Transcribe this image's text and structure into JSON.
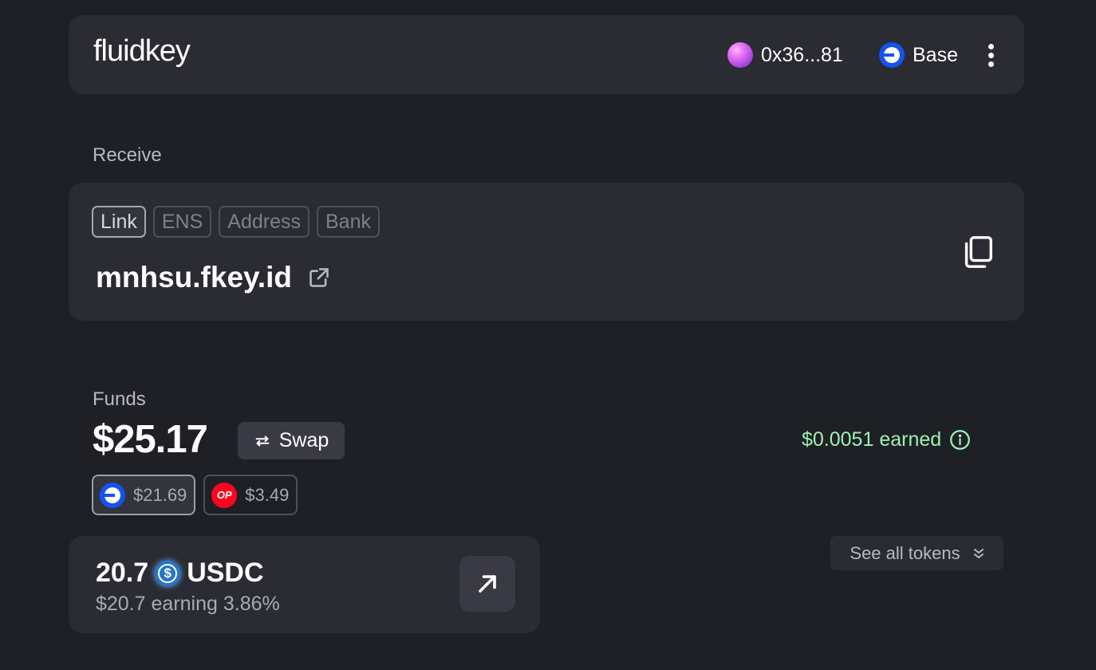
{
  "header": {
    "logo_text": "fluidkey",
    "wallet_address": "0x36...81",
    "network_name": "Base",
    "menu_icon": "more-vertical-icon"
  },
  "receive": {
    "section_label": "Receive",
    "tabs": [
      {
        "label": "Link",
        "active": true
      },
      {
        "label": "ENS",
        "active": false
      },
      {
        "label": "Address",
        "active": false
      },
      {
        "label": "Bank",
        "active": false
      }
    ],
    "link_text": "mnhsu.fkey.id",
    "icons": {
      "external": "external-link-icon",
      "copy": "copy-icon"
    }
  },
  "funds": {
    "section_label": "Funds",
    "balance": "$25.17",
    "swap_label": "Swap",
    "earned_text": "$0.0051 earned",
    "chains": [
      {
        "network": "Base",
        "amount": "$21.69",
        "active": true
      },
      {
        "network": "OP",
        "amount": "$3.49",
        "active": false
      }
    ],
    "token": {
      "amount": "20.7",
      "symbol": "USDC",
      "subtext": "$20.7 earning 3.86%"
    },
    "see_all_label": "See all tokens"
  },
  "colors": {
    "background": "#1f2026",
    "card": "#2a2b33",
    "earned_green": "#9ef0b4",
    "base_blue": "#1652f0",
    "op_red": "#ff0420",
    "usdc_blue": "#2775ca"
  }
}
